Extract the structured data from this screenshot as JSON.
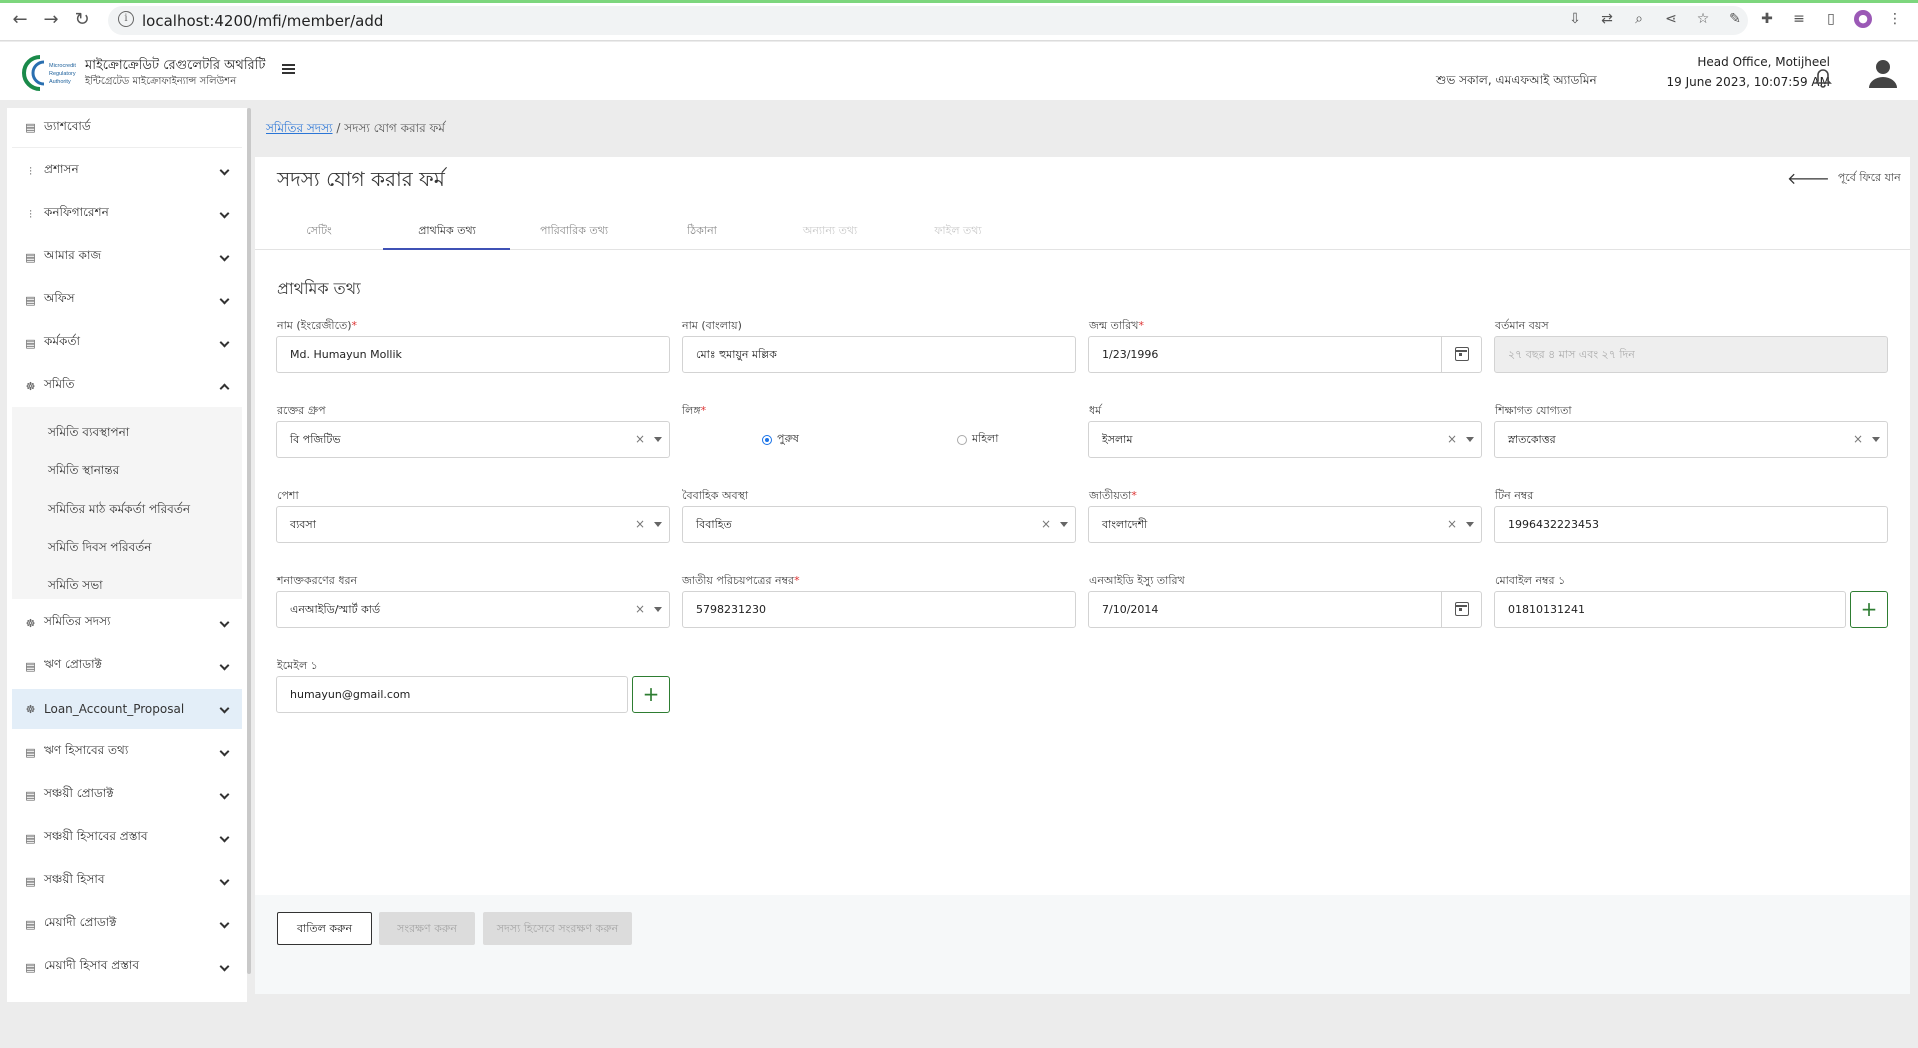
{
  "browser": {
    "url": "localhost:4200/mfi/member/add"
  },
  "header": {
    "brand_title": "মাইক্রোক্রেডিট রেগুলেটরি অথরিটি",
    "brand_sub": "ইন্টিগ্রেটেড মাইক্রোফাইন্যান্স সলিউশন",
    "logo_text": [
      "Microcredit",
      "Regulatory",
      "Authority"
    ],
    "greeting": "শুভ সকাল, এমএফআই অ্যাডমিন",
    "office": "Head Office, Motijheel",
    "datetime": "19 June 2023, 10:07:59 AM"
  },
  "sidebar": {
    "dashboard": "ড্যাশবোর্ড",
    "items": [
      {
        "label": "প্রশাসন",
        "icon": "sliders-icon"
      },
      {
        "label": "কনফিগারেশন",
        "icon": "sliders-icon"
      },
      {
        "label": "আমার কাজ",
        "icon": "doc-icon"
      },
      {
        "label": "অফিস",
        "icon": "doc-icon"
      },
      {
        "label": "কর্মকর্তা",
        "icon": "doc-icon"
      },
      {
        "label": "সমিতি",
        "icon": "group-icon"
      }
    ],
    "submenu": [
      "সমিতি ব্যবস্থাপনা",
      "সমিতি স্থানান্তর",
      "সমিতির মাঠ কর্মকর্তা পরিবর্তন",
      "সমিতি দিবস পরিবর্তন",
      "সমিতি সভা"
    ],
    "items2": [
      {
        "label": "সমিতির সদস্য",
        "icon": "group-icon"
      },
      {
        "label": "ঋণ প্রোডাক্ট",
        "icon": "doc-icon"
      },
      {
        "label": "Loan_Account_Proposal",
        "icon": "group-icon"
      },
      {
        "label": "ঋণ হিসাবের তথ্য",
        "icon": "doc-icon"
      },
      {
        "label": "সঞ্চয়ী প্রোডাক্ট",
        "icon": "doc-icon"
      },
      {
        "label": "সঞ্চয়ী হিসাবের প্রস্তাব",
        "icon": "doc-icon"
      },
      {
        "label": "সঞ্চয়ী হিসাব",
        "icon": "doc-icon"
      },
      {
        "label": "মেয়াদী প্রোডাক্ট",
        "icon": "doc-icon"
      },
      {
        "label": "মেয়াদী হিসাব প্রস্তাব",
        "icon": "doc-icon"
      }
    ]
  },
  "breadcrumb": {
    "parent": "সমিতির সদস্য",
    "separator": "/",
    "current": "সদস্য যোগ করার ফর্ম"
  },
  "page": {
    "title": "সদস্য যোগ করার ফর্ম",
    "back_label": "পূর্বে ফিরে যান"
  },
  "tabs": [
    "সেটিং",
    "প্রাথমিক তথ্য",
    "পারিবারিক তথ্য",
    "ঠিকানা",
    "অন্যান্য তথ্য",
    "ফাইল তথ্য"
  ],
  "form": {
    "section_title": "প্রাথমিক তথ্য",
    "name_en": {
      "label": "নাম (ইংরেজীতে)",
      "required": "*",
      "value": "Md. Humayun Mollik"
    },
    "name_bn": {
      "label": "নাম (বাংলায়)",
      "value": "মোঃ হুমায়ুন মল্লিক"
    },
    "dob": {
      "label": "জন্ম তারিখ",
      "required": "*",
      "value": "1/23/1996"
    },
    "age": {
      "label": "বর্তমান বয়স",
      "value": "২৭ বছর ৪ মাস এবং ২৭ দিন"
    },
    "blood": {
      "label": "রক্তের গ্রুপ",
      "value": "বি পজিটিভ"
    },
    "gender": {
      "label": "লিঙ্গ",
      "required": "*",
      "male": "পুরুষ",
      "female": "মহিলা",
      "selected": "male"
    },
    "religion": {
      "label": "ধর্ম",
      "value": "ইসলাম"
    },
    "education": {
      "label": "শিক্ষাগত যোগ্যতা",
      "value": "স্নাতকোত্তর"
    },
    "occupation": {
      "label": "পেশা",
      "value": "ব্যবসা"
    },
    "marital": {
      "label": "বৈবাহিক অবস্থা",
      "value": "বিবাহিত"
    },
    "nationality": {
      "label": "জাতীয়তা",
      "required": "*",
      "value": "বাংলাদেশী"
    },
    "tin": {
      "label": "টিন নম্বর",
      "value": "1996432223453"
    },
    "id_type": {
      "label": "শনাক্তকরণের ধরন",
      "value": "এনআইডি/স্মার্ট কার্ড"
    },
    "nid": {
      "label": "জাতীয় পরিচয়পত্রের নম্বর",
      "required": "*",
      "value": "5798231230"
    },
    "nid_date": {
      "label": "এনআইডি ইস্যু তারিখ",
      "value": "7/10/2014"
    },
    "mobile": {
      "label": "মোবাইল নম্বর ১",
      "value": "01810131241"
    },
    "email": {
      "label": "ইমেইল ১",
      "value": "humayun@gmail.com"
    },
    "clear_glyph": "×",
    "plus_glyph": "+"
  },
  "buttons": {
    "cancel": "বাতিল করুন",
    "save": "সংরক্ষণ করুন",
    "save_member": "সদস্য হিসেবে সংরক্ষণ করুন"
  },
  "colors": {
    "accent": "#3f51b5",
    "link": "#2a75d6",
    "plus": "#2e7d32",
    "required": "#dd3333",
    "active_sidebar": "#e3eef8"
  }
}
